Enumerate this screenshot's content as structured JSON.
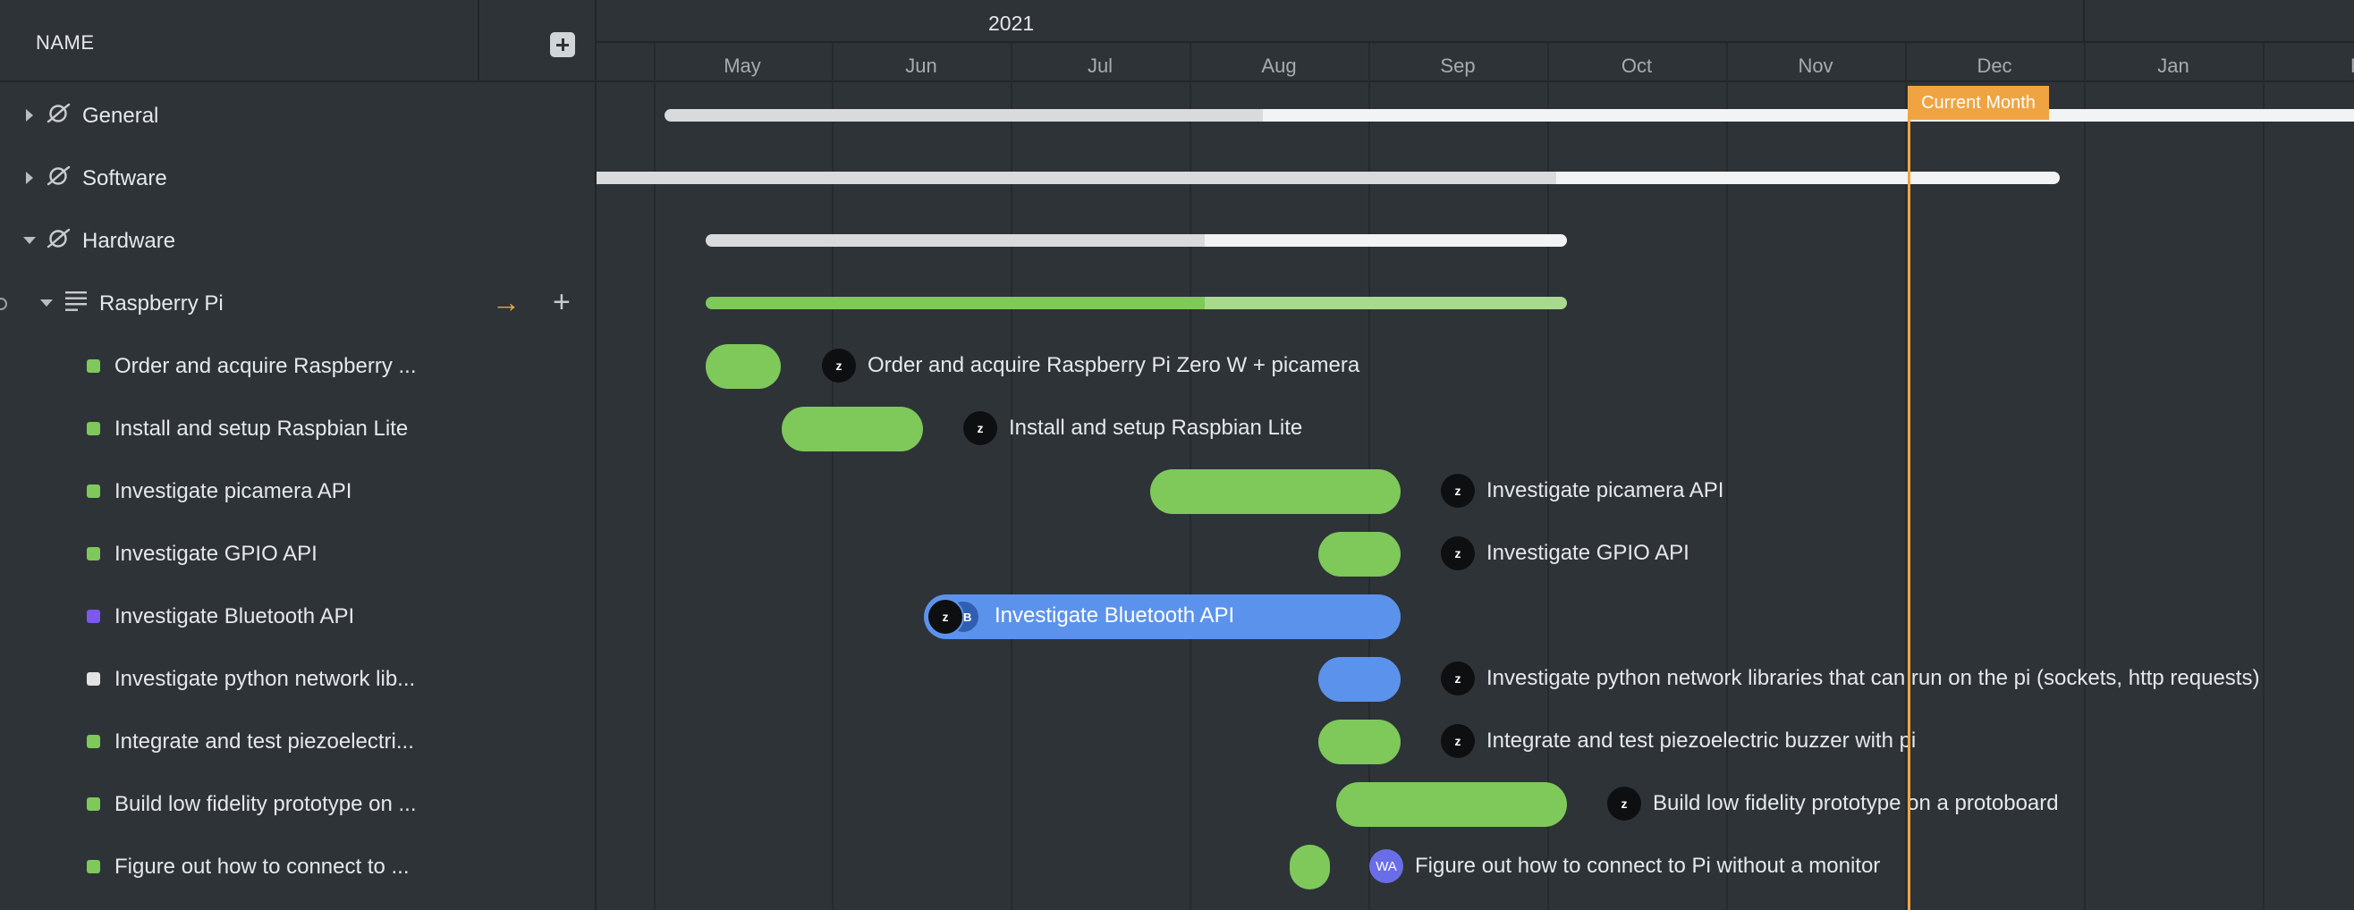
{
  "name_header": {
    "label": "NAME"
  },
  "timeline": {
    "year": "2021",
    "months": [
      "May",
      "Jun",
      "Jul",
      "Aug",
      "Sep",
      "Oct",
      "Nov",
      "Dec",
      "Jan",
      "Fe"
    ],
    "current_month_label": "Current Month"
  },
  "projects": [
    {
      "name": "General",
      "icon": "planet-icon",
      "expanded": false
    },
    {
      "name": "Software",
      "icon": "planet-icon",
      "expanded": false
    },
    {
      "name": "Hardware",
      "icon": "planet-icon",
      "expanded": true
    }
  ],
  "group": {
    "name": "Raspberry Pi",
    "icon": "list-icon",
    "arrow": "→",
    "plus": "+"
  },
  "tasks": [
    {
      "short": "Order and acquire Raspberry ...",
      "full": "Order and acquire Raspberry Pi Zero W + picamera",
      "status_color": "#7ec95a",
      "avatar": "z"
    },
    {
      "short": "Install and setup Raspbian Lite",
      "full": "Install and setup Raspbian Lite",
      "status_color": "#7ec95a",
      "avatar": "z"
    },
    {
      "short": "Investigate picamera API",
      "full": "Investigate picamera API",
      "status_color": "#7ec95a",
      "avatar": "z"
    },
    {
      "short": "Investigate GPIO API",
      "full": "Investigate GPIO API",
      "status_color": "#7ec95a",
      "avatar": "z"
    },
    {
      "short": "Investigate Bluetooth API",
      "full": "Investigate Bluetooth API",
      "status_color": "#7d58f0",
      "avatar": "z",
      "avatar2": "CB"
    },
    {
      "short": "Investigate python network lib...",
      "full": "Investigate python network libraries that can run on the pi (sockets, http requests)",
      "status_color": "#e1e3e5",
      "avatar": "z"
    },
    {
      "short": "Integrate and test piezoelectri...",
      "full": "Integrate and test piezoelectric buzzer with pi",
      "status_color": "#7ec95a",
      "avatar": "z"
    },
    {
      "short": "Build low fidelity prototype on ...",
      "full": "Build low fidelity prototype on a protoboard",
      "status_color": "#7ec95a",
      "avatar": "z"
    },
    {
      "short": "Figure out how to connect to ...",
      "full": "Figure out how to connect to Pi without a monitor",
      "status_color": "#7ec95a",
      "avatar": "WA"
    }
  ],
  "colors": {
    "background": "#2e3338",
    "green": "#7ec95a",
    "green_light": "#a9d98e",
    "blue": "#5b93ec",
    "accent_orange": "#f0a441",
    "track_done": "#d8dadc",
    "track_todo": "#f2f3f4",
    "avatar_dark": "#0e0f10",
    "avatar_purple": "#6a6de8"
  }
}
